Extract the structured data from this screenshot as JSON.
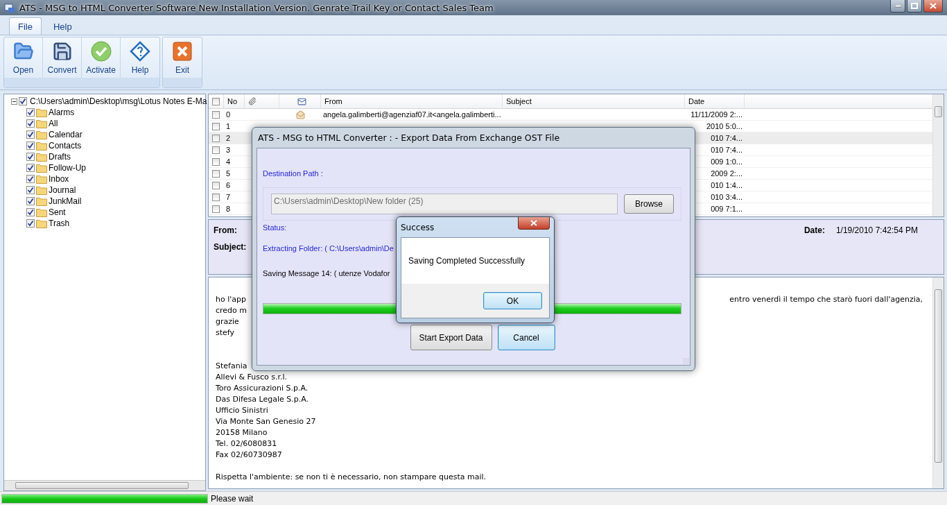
{
  "window": {
    "title": "ATS - MSG to HTML Converter Software New Installation Version. Genrate Trail Key or Contact Sales Team"
  },
  "menu_tabs": [
    {
      "label": "File",
      "selected": true
    },
    {
      "label": "Help",
      "selected": false
    }
  ],
  "toolbar": {
    "groups": [
      {
        "buttons": [
          {
            "kind": "open",
            "label": "Open"
          },
          {
            "kind": "convert",
            "label": "Convert"
          },
          {
            "kind": "activate",
            "label": "Activate"
          },
          {
            "kind": "help",
            "label": "Help"
          }
        ]
      },
      {
        "buttons": [
          {
            "kind": "exit",
            "label": "Exit"
          }
        ]
      }
    ]
  },
  "folder_tree": {
    "label": "C:\\Users\\admin\\Desktop\\msg\\Lotus Notes E-Ma",
    "checked": true,
    "expanded": true,
    "children": [
      {
        "label": "Alarms",
        "checked": true
      },
      {
        "label": "All",
        "checked": true
      },
      {
        "label": "Calendar",
        "checked": true
      },
      {
        "label": "Contacts",
        "checked": true
      },
      {
        "label": "Drafts",
        "checked": true
      },
      {
        "label": "Follow-Up",
        "checked": true
      },
      {
        "label": "Inbox",
        "checked": true
      },
      {
        "label": "Journal",
        "checked": true
      },
      {
        "label": "JunkMail",
        "checked": true
      },
      {
        "label": "Sent",
        "checked": true
      },
      {
        "label": "Trash",
        "checked": true
      }
    ]
  },
  "message_table": {
    "columns": {
      "no": "No",
      "from": "From",
      "subject": "Subject",
      "date": "Date"
    },
    "all_checked": false,
    "rows": [
      {
        "no": "0",
        "checked": false,
        "selected": false,
        "read": true,
        "from": "angela.galimberti@agenziaf07.it<angela.galimberti...",
        "date": "11/11/2009 2:..."
      },
      {
        "no": "1",
        "checked": false,
        "selected": false,
        "date": "2010 5:0..."
      },
      {
        "no": "2",
        "checked": false,
        "selected": true,
        "date": "010 7:4..."
      },
      {
        "no": "3",
        "checked": false,
        "selected": false,
        "date": "010 7:4..."
      },
      {
        "no": "4",
        "checked": false,
        "selected": false,
        "date": "009 1:0..."
      },
      {
        "no": "5",
        "checked": false,
        "selected": false,
        "date": "2009 2:..."
      },
      {
        "no": "6",
        "checked": false,
        "selected": false,
        "date": "010 1:4..."
      },
      {
        "no": "7",
        "checked": false,
        "selected": false,
        "date": "010 3:4..."
      },
      {
        "no": "8",
        "checked": false,
        "selected": false,
        "date": "009 7:1..."
      }
    ]
  },
  "preview": {
    "from_label": "From:",
    "subject_label": "Subject:",
    "date_label": "Date:",
    "date": "1/19/2010 7:42:54 PM"
  },
  "message_body": {
    "lines": [
      {
        "text": "ho l'app",
        "tail": "entro venerdì il tempo che starò fuori dall'agenzia,"
      },
      {
        "text": "credo m"
      },
      {
        "text": "grazie"
      },
      {
        "text": "stefy"
      },
      {
        "kind": "blank"
      },
      {
        "kind": "blank"
      },
      {
        "text": "Stefania"
      },
      {
        "text": "Allevi & Fusco s.r.l."
      },
      {
        "text": "Toro Assicurazioni S.p.A."
      },
      {
        "text": "Das Difesa Legale S.p.A."
      },
      {
        "text": "Ufficio Sinistri"
      },
      {
        "text": "Via Monte San Genesio 27"
      },
      {
        "text": "20158 Milano"
      },
      {
        "text": "Tel. 02/6080831"
      },
      {
        "text": "Fax 02/60730987"
      },
      {
        "kind": "blank"
      },
      {
        "text": "Rispetta l'ambiente: se non ti è necessario, non stampare questa mail."
      }
    ]
  },
  "status_bar": {
    "level": 1,
    "text": "Please wait"
  },
  "export_dialog": {
    "title": "ATS - MSG to HTML Converter : - Export Data From Exchange OST File",
    "destination_label": "Destination Path :",
    "path": "C:\\Users\\admin\\Desktop\\New folder (25)",
    "browse": "Browse",
    "status_label": "Status:",
    "extracting": "Extracting Folder: ( C:\\Users\\admin\\De",
    "saving": "Saving Message 14: ( utenze Vodafor",
    "level": 1,
    "start": "Start Export Data",
    "cancel": "Cancel"
  },
  "success_dialog": {
    "title": "Success",
    "message": "Saving Completed Successfully",
    "ok": "OK"
  }
}
